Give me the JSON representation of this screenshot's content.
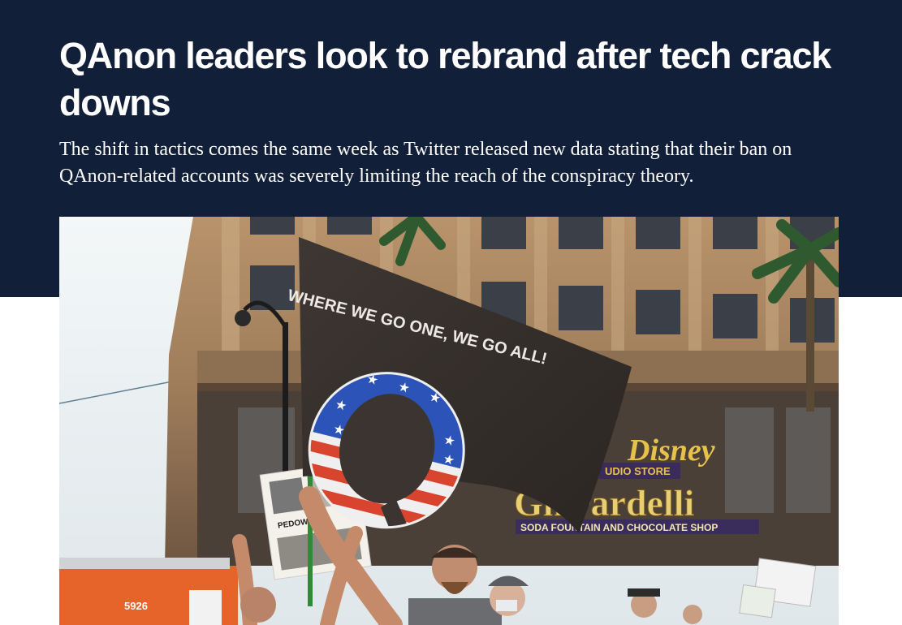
{
  "article": {
    "headline": "QAnon leaders look to rebrand after tech crack downs",
    "dek": "The shift in tactics comes the same week as Twitter released new data stating that their ban on QAnon-related accounts was severely limiting the reach of the conspiracy theory."
  },
  "hero_image": {
    "flag_slogan": "WHERE WE GO ONE, WE GO ALL!",
    "flag_letter": "Q",
    "store_sign": "DISNEY STUDIO STORE",
    "shop_name": "Ghirardelli",
    "shop_subtitle": "SODA FOUNTAIN AND CHOCOLATE SHOP",
    "sign_heading": "PEDOWOOD",
    "bus_number": "5926"
  },
  "colors": {
    "header_background": "#121f39",
    "headline_text": "#ffffff",
    "page_background": "#ffffff"
  }
}
